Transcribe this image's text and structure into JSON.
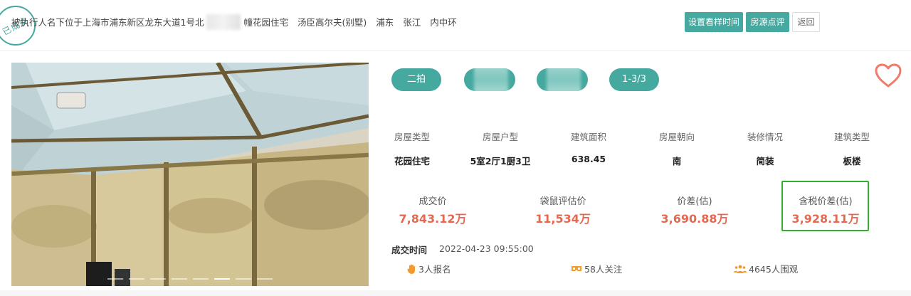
{
  "header": {
    "stamp": "已成交",
    "title_before": "被执行人名下位于上海市浦东新区龙东大道1号北",
    "title_after": "幢花园住宅",
    "tags": [
      "汤臣高尔夫(别墅)",
      "浦东",
      "张江",
      "内中环"
    ],
    "buttons": {
      "schedule": "设置看样时间",
      "review": "房源点评",
      "back": "返回"
    }
  },
  "colors": {
    "accent": "#45a9a0",
    "price": "#e8674f",
    "highlight": "#2fb02f",
    "heart": "#ef7b6a"
  },
  "gallery": {
    "slide_count": 8,
    "active_index": 5
  },
  "pills": {
    "auction_round": "二拍",
    "counter": "1-3/3"
  },
  "attributes": [
    {
      "label": "房屋类型",
      "value": "花园住宅"
    },
    {
      "label": "房屋户型",
      "value": "5室2厅1厨3卫"
    },
    {
      "label": "建筑面积",
      "value": "638.45"
    },
    {
      "label": "房屋朝向",
      "value": "南"
    },
    {
      "label": "装修情况",
      "value": "简装"
    },
    {
      "label": "建筑类型",
      "value": "板楼"
    }
  ],
  "prices": [
    {
      "label": "成交价",
      "value": "7,843.12万"
    },
    {
      "label": "袋鼠评估价",
      "value": "11,534万"
    },
    {
      "label": "价差(估)",
      "value": "3,690.88万"
    },
    {
      "label": "含税价差(估)",
      "value": "3,928.11万"
    }
  ],
  "deal": {
    "label": "成交时间",
    "time": "2022-04-23 09:55:00"
  },
  "stats": {
    "signups": "3人报名",
    "followers": "58人关注",
    "viewers": "4645人围观"
  }
}
